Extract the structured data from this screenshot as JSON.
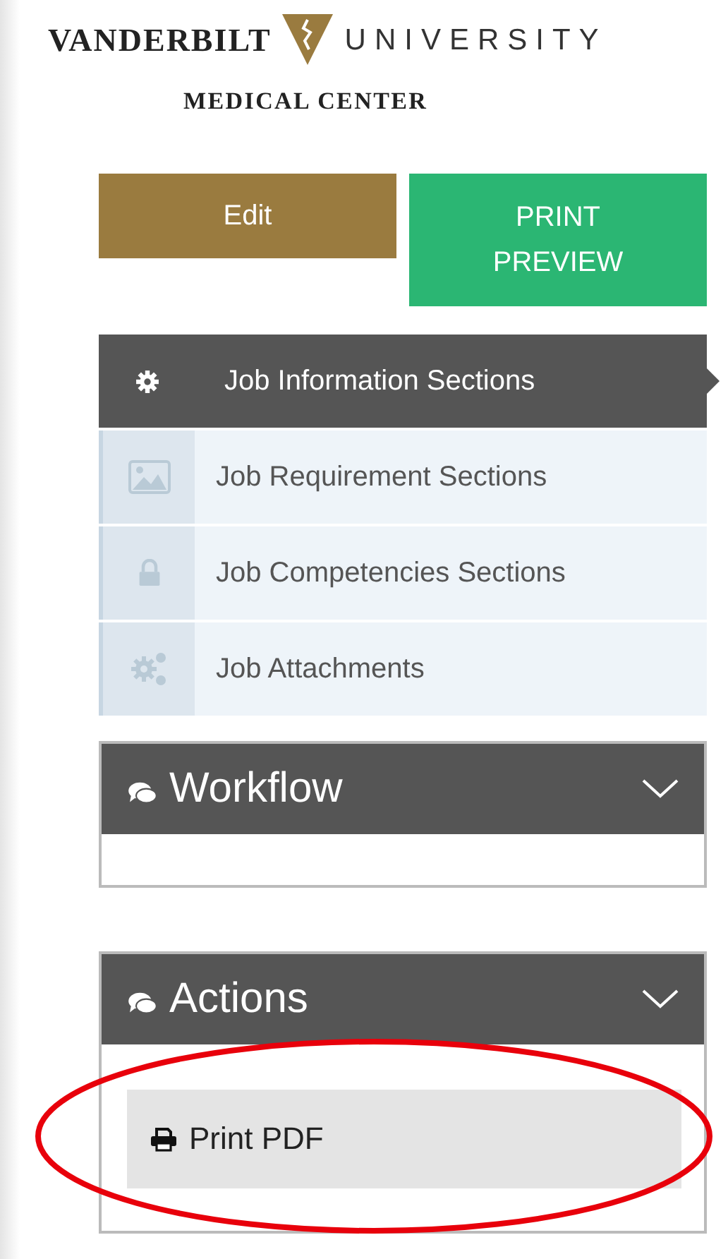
{
  "logo": {
    "left": "VANDERBILT",
    "right": "UNIVERSITY",
    "subtitle": "MEDICAL CENTER"
  },
  "buttons": [
    {
      "label": "Edit",
      "kind": "edit"
    },
    {
      "label": "PRINT PREVIEW",
      "kind": "preview"
    }
  ],
  "sections": [
    {
      "label": "Job Information Sections",
      "kind": "gear",
      "selected": true
    },
    {
      "label": "Job Requirement Sections",
      "kind": "image",
      "selected": false
    },
    {
      "label": "Job Competencies Sections",
      "kind": "lock",
      "selected": false
    },
    {
      "label": "Job Attachments",
      "kind": "gears",
      "selected": false
    }
  ],
  "panels": [
    {
      "title": "Workflow"
    },
    {
      "title": "Actions",
      "items": [
        {
          "label": "Print PDF"
        }
      ]
    }
  ]
}
